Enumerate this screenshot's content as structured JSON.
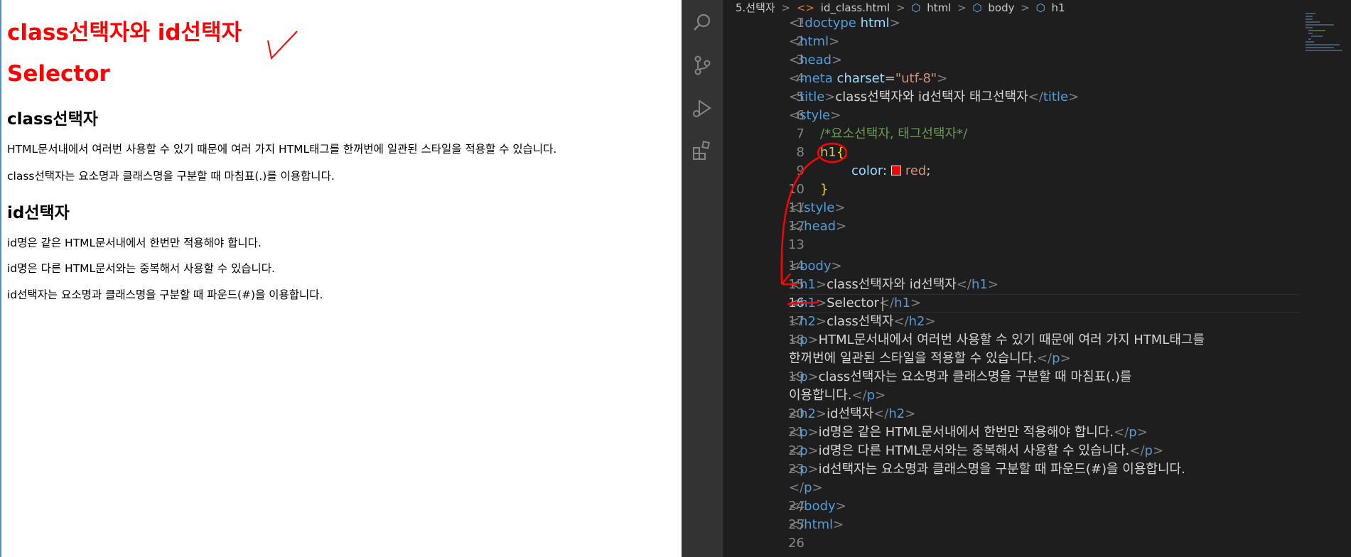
{
  "preview": {
    "h1_first": "class선택자와 id선택자",
    "h1_second": "Selector",
    "h2_class": "class선택자",
    "p1": "HTML문서내에서 여러번 사용할 수 있기 때문에 여러 가지 HTML태그를 한꺼번에 일관된 스타일을 적용할 수 있습니다.",
    "p2": "class선택자는 요소명과 클래스명을 구분할 때 마침표(.)를 이용합니다.",
    "h2_id": "id선택자",
    "p3": "id명은 같은 HTML문서내에서 한번만 적용해야 합니다.",
    "p4": "id명은 다른 HTML문서와는 중복해서 사용할 수 있습니다.",
    "p5": "id선택자는 요소명과 클래스명을 구분할 때 파운드(#)을 이용합니다."
  },
  "breadcrumb": {
    "folder": "5.선택자",
    "file": "id_class.html",
    "html": "html",
    "body": "body",
    "h1": "h1",
    "sep": ">"
  },
  "activity": {
    "icons": [
      "search-icon",
      "source-control-icon",
      "run-debug-icon",
      "extensions-icon"
    ]
  },
  "colors": {
    "accent_red": "#ff0000",
    "editor_bg": "#1e1e1e",
    "activity_bg": "#333333",
    "tag_blue": "#569cd6",
    "comment_green": "#6a9955",
    "string_orange": "#ce9178"
  },
  "editor": {
    "active_line": "16",
    "line_numbers": [
      "1",
      "2",
      "3",
      "4",
      "5",
      "6",
      "7",
      "8",
      "9",
      "10",
      "11",
      "12",
      "13",
      "14",
      "15",
      "16",
      "17",
      "18",
      "19",
      "20",
      "21",
      "22",
      "23",
      "24",
      "25",
      "26"
    ],
    "l1": {
      "lt": "<!",
      "kw": "doctype",
      "name": " html",
      "gt": ">"
    },
    "l2": {
      "open": "<",
      "tag": "html",
      "close": ">"
    },
    "l3": {
      "open": "<",
      "tag": "head",
      "close": ">"
    },
    "l4": {
      "open": "<",
      "tag": "meta",
      "attr": " charset",
      "eq": "=",
      "val": "\"utf-8\"",
      "close": ">"
    },
    "l5": {
      "open": "<",
      "tag": "title",
      "close": ">",
      "text": "class선택자와 id선택자 태그선택자",
      "eopen": "</",
      "etag": "title",
      "eclose": ">"
    },
    "l6": {
      "open": "<",
      "tag": "style",
      "close": ">"
    },
    "l7": {
      "comment": "/*요소선택자, 태그선택자*/"
    },
    "l8": {
      "sel": "h1",
      "brace": "{"
    },
    "l9": {
      "prop": "color",
      "colon": ": ",
      "val": "red",
      "semi": ";"
    },
    "l10": {
      "brace": "}"
    },
    "l11": {
      "eopen": "</",
      "etag": "style",
      "eclose": ">"
    },
    "l12": {
      "eopen": "</",
      "etag": "head",
      "eclose": ">"
    },
    "l14": {
      "open": "<",
      "tag": "body",
      "close": ">"
    },
    "l15": {
      "open": "<",
      "tag": "h1",
      "close": ">",
      "text": "class선택자와 id선택자",
      "eopen": "</",
      "etag": "h1",
      "eclose": ">"
    },
    "l16": {
      "open": "<",
      "tag": "h1",
      "close": ">",
      "text": "Selector",
      "eopen": "</",
      "etag": "h1",
      "eclose": ">"
    },
    "l17": {
      "open": "<",
      "tag": "h2",
      "close": ">",
      "text": "class선택자",
      "eopen": "</",
      "etag": "h2",
      "eclose": ">"
    },
    "l18a": {
      "open": "<",
      "tag": "p",
      "close": ">",
      "text": "HTML문서내에서 여러번 사용할 수 있기 때문에 여러 가지 HTML태그를"
    },
    "l18b": {
      "text": "한꺼번에 일관된 스타일을 적용할 수 있습니다.",
      "eopen": "</",
      "etag": "p",
      "eclose": ">"
    },
    "l19a": {
      "open": "<",
      "tag": "p",
      "close": ">",
      "text": "class선택자는 요소명과 클래스명을 구분할 때 마침표(.)를"
    },
    "l19b": {
      "text": "이용합니다.",
      "eopen": "</",
      "etag": "p",
      "eclose": ">"
    },
    "l20": {
      "open": "<",
      "tag": "h2",
      "close": ">",
      "text": "id선택자",
      "eopen": "</",
      "etag": "h2",
      "eclose": ">"
    },
    "l21": {
      "open": "<",
      "tag": "p",
      "close": ">",
      "text": "id명은 같은 HTML문서내에서 한번만 적용해야 합니다.",
      "eopen": "</",
      "etag": "p",
      "eclose": ">"
    },
    "l22": {
      "open": "<",
      "tag": "p",
      "close": ">",
      "text": "id명은 다른 HTML문서와는 중복해서 사용할 수 있습니다.",
      "eopen": "</",
      "etag": "p",
      "eclose": ">"
    },
    "l23a": {
      "open": "<",
      "tag": "p",
      "close": ">",
      "text": "id선택자는 요소명과 클래스명을 구분할 때 파운드(#)을 이용합니다."
    },
    "l23b": {
      "eopen": "</",
      "etag": "p",
      "eclose": ">"
    },
    "l24": {
      "eopen": "</",
      "etag": "body",
      "eclose": ">"
    },
    "l25": {
      "eopen": "</",
      "etag": "html",
      "eclose": ">"
    }
  }
}
